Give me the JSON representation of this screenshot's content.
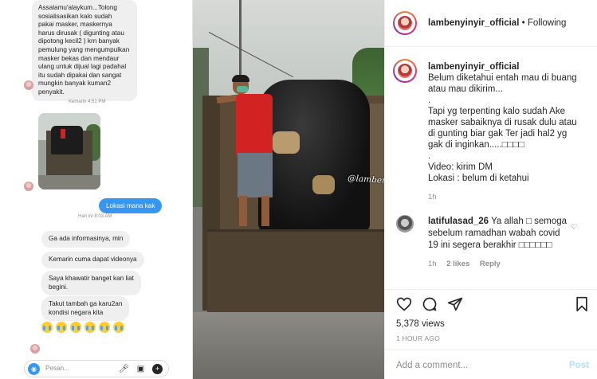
{
  "chat": {
    "incoming_message_1": [
      "Assalamu'alaykum...Tolong",
      "sosialisasikan kalo sudah",
      "pakai masker, maskernya",
      "harus dirusak ( digunting atau",
      "dipotong kecil2 ) krn banyak",
      "pemulung yang mengumpulkan",
      "masker bekas dan mendaur",
      "ulang untuk dijual lagi padahal",
      "itu sudah dipakai dan sangat",
      "mungkin banyak kuman2",
      "penyakit."
    ],
    "time_1": "Kemarin 4:51 PM",
    "outgoing_message": "Lokasi mana kak",
    "time_2": "Hari ini 8:03 AM",
    "replies": [
      [
        "Ga ada informasinya, min"
      ],
      [
        "Kemarin cuma dapat videonya"
      ],
      [
        "Saya  khawatir banget kan liat",
        "begini."
      ],
      [
        "Takut tambah ga karu2an",
        "kondisi negara kita"
      ]
    ],
    "composer_placeholder": "Pesan...",
    "icons": [
      "camera-icon",
      "microphone-icon",
      "image-icon",
      "plus-icon"
    ]
  },
  "video": {
    "watermark": "@lambenyinyir_official"
  },
  "post": {
    "header": {
      "username": "lambenyinyir_official",
      "separator": "•",
      "follow_status": "Following"
    },
    "caption": {
      "username": "lambenyinyir_official",
      "lines": [
        ".",
        "Belum diketahui entah mau di buang",
        "atau mau dikirim...",
        ".",
        "Tapi yg terpenting kalo sudah Ake",
        "masker sabaiknya di rusak dulu atau",
        "di gunting biar gak Ter jadi hal2 yg",
        "gak di inginkan.....□□□□",
        ".",
        "Video: kirim DM",
        "Lokasi : belum di ketahui"
      ],
      "time": "1h"
    },
    "comment": {
      "username": "latifulasad_26",
      "lines": [
        "Ya allah □ semoga",
        "sebelum ramadhan wabah covid",
        "19 ini segera berakhir □□□□□□"
      ],
      "time": "1h",
      "likes": "2 likes",
      "reply": "Reply"
    },
    "views": "5,378 views",
    "posted": "1 HOUR AGO",
    "add_comment_placeholder": "Add a comment...",
    "post_button": "Post"
  }
}
